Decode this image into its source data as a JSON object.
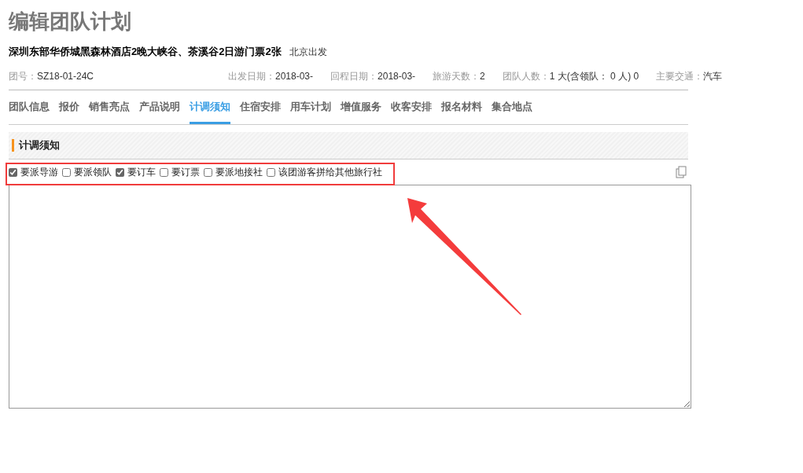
{
  "page_title": "编辑团队计划",
  "tour": {
    "name": "深圳东部华侨城黑森林酒店2晚大峡谷、茶溪谷2日游门票2张",
    "departure": "北京出发"
  },
  "info": [
    {
      "label": "团号：",
      "value": "SZ18-01-24C"
    },
    {
      "label": "出发日期：",
      "value": "2018-03-"
    },
    {
      "label": "回程日期：",
      "value": "2018-03-"
    },
    {
      "label": "旅游天数：",
      "value": "2"
    },
    {
      "label": "团队人数：",
      "value": "1 大(含领队： 0 人) 0"
    },
    {
      "label": "主要交通：",
      "value": "汽车"
    }
  ],
  "tabs": [
    {
      "label": "团队信息",
      "selected": false
    },
    {
      "label": "报价",
      "selected": false
    },
    {
      "label": "销售亮点",
      "selected": false
    },
    {
      "label": "产品说明",
      "selected": false
    },
    {
      "label": "计调须知",
      "selected": true
    },
    {
      "label": "住宿安排",
      "selected": false
    },
    {
      "label": "用车计划",
      "selected": false
    },
    {
      "label": "增值服务",
      "selected": false
    },
    {
      "label": "收客安排",
      "selected": false
    },
    {
      "label": "报名材料",
      "selected": false
    },
    {
      "label": "集合地点",
      "selected": false
    }
  ],
  "section": {
    "title": "计调须知",
    "options": [
      {
        "label": "要派导游",
        "checked": true
      },
      {
        "label": "要派领队",
        "checked": false
      },
      {
        "label": "要订车",
        "checked": true
      },
      {
        "label": "要订票",
        "checked": false
      },
      {
        "label": "要派地接社",
        "checked": false
      },
      {
        "label": "该团游客拼给其他旅行社",
        "checked": false
      }
    ]
  }
}
